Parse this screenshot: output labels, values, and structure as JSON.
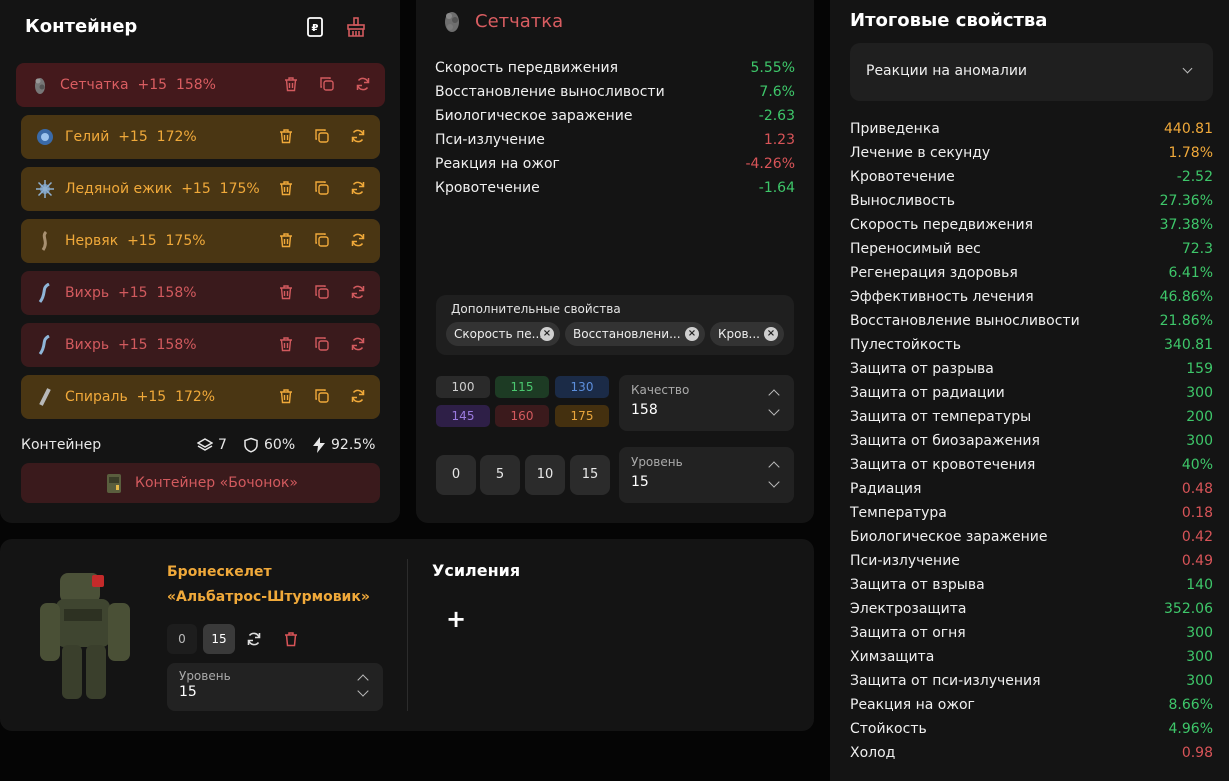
{
  "container_panel": {
    "title": "Контейнер",
    "slots": [
      {
        "name": "Сетчатка",
        "level": "+15",
        "percent": "158%",
        "style": "redsel",
        "icon": "setchatka-artifact-icon"
      },
      {
        "name": "Гелий",
        "level": "+15",
        "percent": "172%",
        "style": "gold",
        "icon": "geliy-artifact-icon"
      },
      {
        "name": "Ледяной ежик",
        "level": "+15",
        "percent": "175%",
        "style": "gold",
        "icon": "ice-hedgehog-artifact-icon"
      },
      {
        "name": "Нервяк",
        "level": "+15",
        "percent": "175%",
        "style": "gold",
        "icon": "nervyak-artifact-icon"
      },
      {
        "name": "Вихрь",
        "level": "+15",
        "percent": "158%",
        "style": "red",
        "icon": "vikhr-artifact-icon"
      },
      {
        "name": "Вихрь",
        "level": "+15",
        "percent": "158%",
        "style": "red",
        "icon": "vikhr-artifact-icon"
      },
      {
        "name": "Спираль",
        "level": "+15",
        "percent": "172%",
        "style": "gold",
        "icon": "spiral-artifact-icon"
      }
    ],
    "footer": {
      "label": "Контейнер",
      "slots_count": "7",
      "protection": "60%",
      "efficiency": "92.5%"
    },
    "container_button": "Контейнер «Бочонок»"
  },
  "artifact_panel": {
    "title": "Сетчатка",
    "stats": [
      {
        "name": "Скорость передвижения",
        "value": "5.55%",
        "tone": "pos"
      },
      {
        "name": "Восстановление выносливости",
        "value": "7.6%",
        "tone": "pos"
      },
      {
        "name": "Биологическое заражение",
        "value": "-2.63",
        "tone": "pos"
      },
      {
        "name": "Пси-излучение",
        "value": "1.23",
        "tone": "neg"
      },
      {
        "name": "Реакция на ожог",
        "value": "-4.26%",
        "tone": "neg"
      },
      {
        "name": "Кровотечение",
        "value": "-1.64",
        "tone": "pos"
      }
    ],
    "additional": {
      "label": "Дополнительные свойства",
      "chips": [
        "Скорость пе...",
        "Восстановлени...",
        "Кров..."
      ]
    },
    "quality_presets": [
      "100",
      "115",
      "130",
      "145",
      "160",
      "175"
    ],
    "quality": {
      "label": "Качество",
      "value": "158"
    },
    "level_presets": [
      "0",
      "5",
      "10",
      "15"
    ],
    "level": {
      "label": "Уровень",
      "value": "15"
    }
  },
  "armor_panel": {
    "name_line1": "Бронескелет",
    "name_line2": "«Альбатрос-Штурмовик»",
    "level_buttons": [
      "0",
      "15"
    ],
    "level": {
      "label": "Уровень",
      "value": "15"
    },
    "boosts_title": "Усиления",
    "add_label": "+"
  },
  "total_panel": {
    "title": "Итоговые свойства",
    "dropdown": "Реакции на аномалии",
    "stats": [
      {
        "name": "Приведенка",
        "value": "440.81",
        "tone": "gold"
      },
      {
        "name": "Лечение в секунду",
        "value": "1.78%",
        "tone": "gold"
      },
      {
        "name": "Кровотечение",
        "value": "-2.52",
        "tone": "pos"
      },
      {
        "name": "Выносливость",
        "value": "27.36%",
        "tone": "pos"
      },
      {
        "name": "Скорость передвижения",
        "value": "37.38%",
        "tone": "pos"
      },
      {
        "name": "Переносимый вес",
        "value": "72.3",
        "tone": "pos"
      },
      {
        "name": "Регенерация здоровья",
        "value": "6.41%",
        "tone": "pos"
      },
      {
        "name": "Эффективность лечения",
        "value": "46.86%",
        "tone": "pos"
      },
      {
        "name": "Восстановление выносливости",
        "value": "21.86%",
        "tone": "pos"
      },
      {
        "name": "Пулестойкость",
        "value": "340.81",
        "tone": "pos"
      },
      {
        "name": "Защита от разрыва",
        "value": "159",
        "tone": "pos"
      },
      {
        "name": "Защита от радиации",
        "value": "300",
        "tone": "pos"
      },
      {
        "name": "Защита от температуры",
        "value": "200",
        "tone": "pos"
      },
      {
        "name": "Защита от биозаражения",
        "value": "300",
        "tone": "pos"
      },
      {
        "name": "Защита от кровотечения",
        "value": "40%",
        "tone": "pos"
      },
      {
        "name": "Радиация",
        "value": "0.48",
        "tone": "neg"
      },
      {
        "name": "Температура",
        "value": "0.18",
        "tone": "neg"
      },
      {
        "name": "Биологическое заражение",
        "value": "0.42",
        "tone": "neg"
      },
      {
        "name": "Пси-излучение",
        "value": "0.49",
        "tone": "neg"
      },
      {
        "name": "Защита от взрыва",
        "value": "140",
        "tone": "pos"
      },
      {
        "name": "Электрозащита",
        "value": "352.06",
        "tone": "pos"
      },
      {
        "name": "Защита от огня",
        "value": "300",
        "tone": "pos"
      },
      {
        "name": "Химзащита",
        "value": "300",
        "tone": "pos"
      },
      {
        "name": "Защита от пси-излучения",
        "value": "300",
        "tone": "pos"
      },
      {
        "name": "Реакция на ожог",
        "value": "8.66%",
        "tone": "pos"
      },
      {
        "name": "Стойкость",
        "value": "4.96%",
        "tone": "pos"
      },
      {
        "name": "Холод",
        "value": "0.98",
        "tone": "neg"
      }
    ]
  },
  "colors": {
    "positive": "#3ec76a",
    "negative": "#d85458",
    "gold": "#f0a93a",
    "gold_bg": "#4a3613",
    "red_bg": "#3a1a1c"
  }
}
